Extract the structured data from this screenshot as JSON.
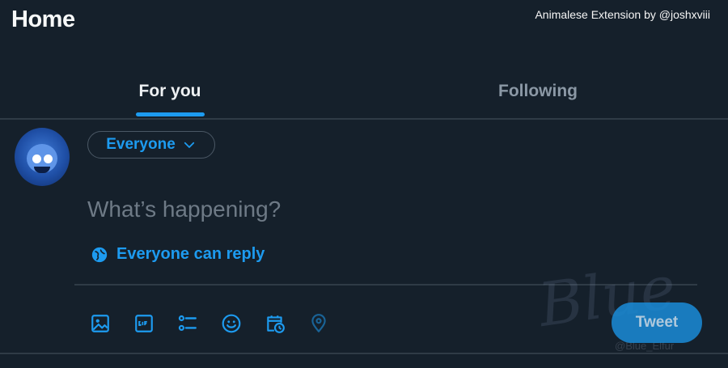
{
  "header": {
    "title": "Home"
  },
  "overlay": {
    "credit": "Animalese Extension by @joshxviii"
  },
  "tabs": [
    {
      "label": "For you",
      "active": true
    },
    {
      "label": "Following",
      "active": false
    }
  ],
  "composer": {
    "audience_label": "Everyone",
    "placeholder": "What’s happening?",
    "reply_setting": "Everyone can reply",
    "tools": [
      "media-icon",
      "gif-icon",
      "poll-icon",
      "emoji-icon",
      "schedule-icon",
      "location-icon"
    ],
    "tweet_label": "Tweet"
  },
  "watermark": {
    "text": "Blue",
    "handle": "@Blue_Elfur"
  },
  "colors": {
    "background": "#15202b",
    "accent": "#1d9bf0",
    "divider": "#2f3b46",
    "muted_text": "#8b98a5"
  }
}
